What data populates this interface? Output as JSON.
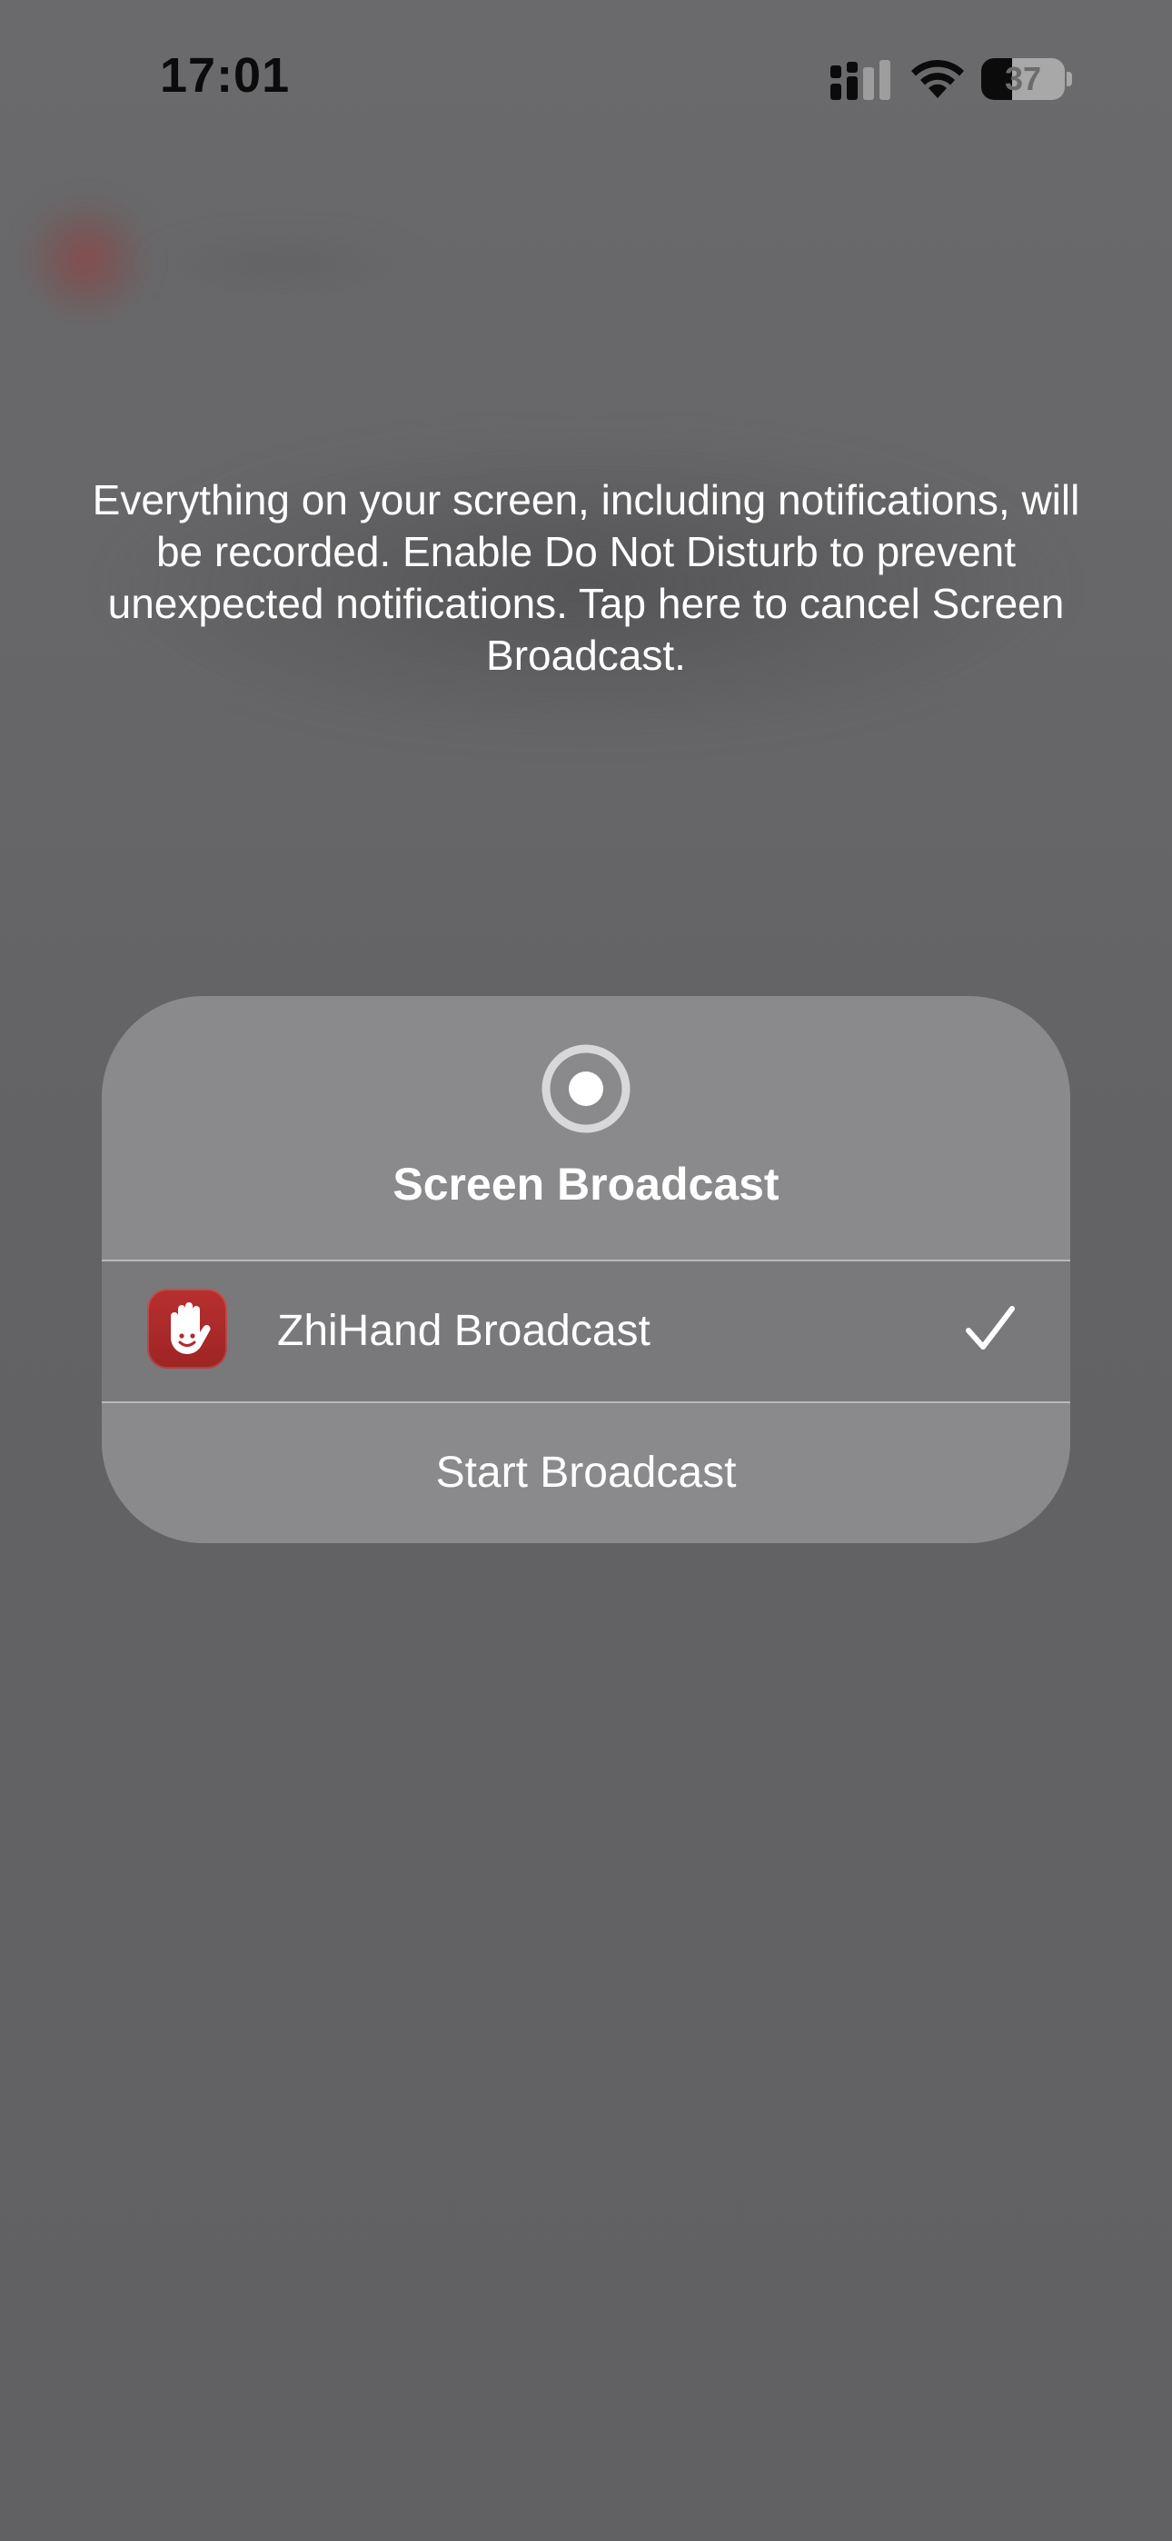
{
  "status_bar": {
    "time": "17:01",
    "battery_level": "37",
    "battery_fraction": 0.37,
    "icons": [
      "cellular-signal-icon",
      "wifi-icon",
      "battery-icon"
    ]
  },
  "warning": {
    "text": "Everything on your screen, including notifications, will be recorded. Enable Do Not Disturb to prevent unexpected notifications. Tap here to cancel Screen Broadcast."
  },
  "sheet": {
    "icon": "screen-record-icon",
    "title": "Screen Broadcast",
    "broadcast_option": {
      "label": "ZhiHand Broadcast",
      "app_icon": "zhihand-hand-icon",
      "selected": true,
      "selected_icon": "checkmark-icon"
    },
    "start_label": "Start Broadcast"
  },
  "colors": {
    "background": "#636365",
    "sheet": "#8a8a8c",
    "selected_row": "#79797b",
    "app_icon": "#b02a2a",
    "text": "#ffffff"
  }
}
